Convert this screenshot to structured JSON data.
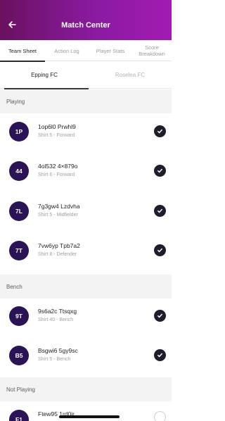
{
  "header": {
    "title": "Match Center"
  },
  "tabs": [
    {
      "label": "Team Sheet"
    },
    {
      "label": "Action Log"
    },
    {
      "label": "Player Stats"
    },
    {
      "label": "Score Breakdown"
    }
  ],
  "teams": [
    {
      "label": "Epping FC"
    },
    {
      "label": "Roselea FC"
    }
  ],
  "sections": {
    "playing": "Playing",
    "bench": "Bench",
    "not_playing": "Not Playing"
  },
  "players": {
    "playing": [
      {
        "initials": "1P",
        "name": "1op6l0 Prwhl9",
        "detail": "Shirt 5 - Forward",
        "checked": true
      },
      {
        "initials": "44",
        "name": "4ol532 4×879o",
        "detail": "Shirt 6 - Forward",
        "checked": true
      },
      {
        "initials": "7L",
        "name": "7g3gw4 Lzdvha",
        "detail": "Shirt 5 - Midfielder",
        "checked": true
      },
      {
        "initials": "7T",
        "name": "7vw6yp Tpb7a2",
        "detail": "Shirt 8 - Defender",
        "checked": true
      }
    ],
    "bench": [
      {
        "initials": "9T",
        "name": "9s6a2c Ttsqxg",
        "detail": "Shirt 40 - Bench",
        "checked": true
      },
      {
        "initials": "B5",
        "name": "Bsgwi6 5gy9sc",
        "detail": "Shirt 5 - Bench",
        "checked": true
      }
    ],
    "not_playing": [
      {
        "initials": "F1",
        "name": "Ftew95 1rd0ir",
        "detail": "",
        "checked": false
      }
    ]
  },
  "colors": {
    "header_start": "#6a1160",
    "header_end": "#a21bb2",
    "avatar": "#2b1456",
    "check": "#1d1d2b"
  },
  "icons": {
    "back": "arrow-left-icon",
    "check": "checkmark-icon"
  }
}
